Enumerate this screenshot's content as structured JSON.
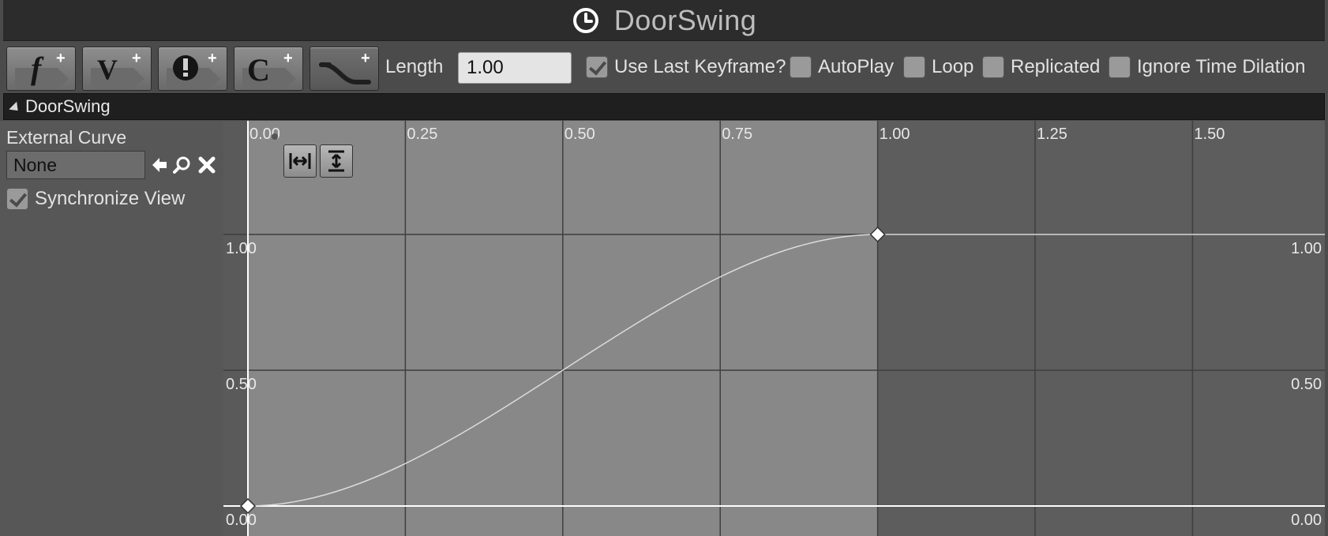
{
  "window": {
    "title": "DoorSwing",
    "title_icon": "clock-icon"
  },
  "toolbar": {
    "buttons": [
      {
        "name": "add-float-track-button",
        "glyph": "f",
        "icon": "float-track-icon"
      },
      {
        "name": "add-vector-track-button",
        "glyph": "V",
        "icon": "vector-track-icon"
      },
      {
        "name": "add-event-track-button",
        "glyph": "!",
        "icon": "event-track-icon"
      },
      {
        "name": "add-color-track-button",
        "glyph": "C",
        "icon": "color-track-icon"
      },
      {
        "name": "add-curve-asset-button",
        "glyph": "",
        "icon": "curve-icon"
      }
    ],
    "length_label": "Length",
    "length_value": "1.00",
    "checkboxes": [
      {
        "label": "Use Last Keyframe?",
        "checked": true
      },
      {
        "label": "AutoPlay",
        "checked": false
      },
      {
        "label": "Loop",
        "checked": false
      },
      {
        "label": "Replicated",
        "checked": false
      },
      {
        "label": "Ignore Time Dilation",
        "checked": false
      }
    ]
  },
  "track": {
    "name": "DoorSwing",
    "external_curve_label": "External Curve",
    "external_curve_value": "None",
    "synchronize_view_label": "Synchronize View",
    "synchronize_view_checked": true
  },
  "graph": {
    "time_ticks": [
      "0.00",
      "0.25",
      "0.50",
      "0.75",
      "1.00",
      "1.25",
      "1.50"
    ],
    "value_ticks": [
      "1.00",
      "0.50",
      "0.00"
    ],
    "active_range_end": 1.0,
    "keyframes": [
      {
        "time": 0.0,
        "value": 0.0
      },
      {
        "time": 1.0,
        "value": 1.0
      }
    ],
    "interpolation": "auto",
    "colors": {
      "active_bg": "#888888",
      "inactive_bg": "#5d5d5d",
      "grid": "#3e3e3e",
      "curve": "#dcdcdc",
      "axis_white": "#ffffff"
    }
  }
}
